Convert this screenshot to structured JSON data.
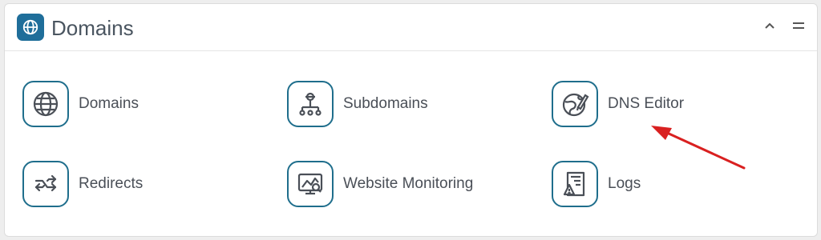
{
  "panel": {
    "title": "Domains",
    "header_icon": "globe-icon",
    "collapse_icon": "chevron-up-icon",
    "menu_icon": "hamburger-icon"
  },
  "tiles": [
    {
      "label": "Domains",
      "icon": "globe-icon"
    },
    {
      "label": "Subdomains",
      "icon": "sitemap-icon"
    },
    {
      "label": "DNS Editor",
      "icon": "dns-editor-icon"
    },
    {
      "label": "Redirects",
      "icon": "redirect-arrows-icon"
    },
    {
      "label": "Website Monitoring",
      "icon": "monitor-chart-icon"
    },
    {
      "label": "Logs",
      "icon": "log-warning-icon"
    }
  ],
  "colors": {
    "accent": "#1f6e9a",
    "tile_border": "#1f6e8c",
    "icon_stroke": "#4a4f57",
    "annotation_arrow": "#d92020"
  }
}
